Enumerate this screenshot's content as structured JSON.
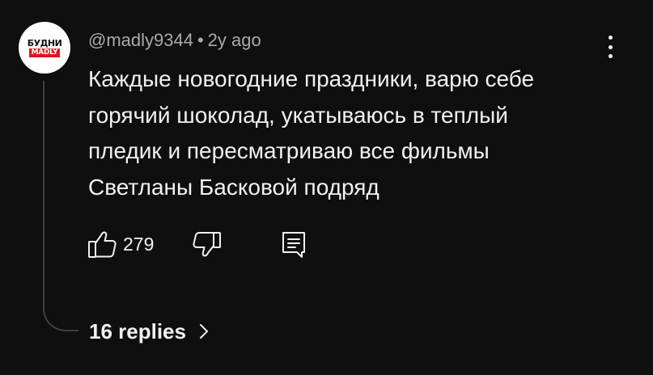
{
  "channel_avatar": {
    "line1": "БУДНИ",
    "line2": "MADLY",
    "accent": "#e3141e"
  },
  "comment": {
    "author": "@madly9344",
    "separator": "•",
    "time": "2y ago",
    "text_lines": [
      "Каждые новогодние праздники, варю себе",
      "горячий шоколад, укатываюсь в теплый",
      "пледик и пересматриваю все фильмы",
      "Светланы Басковой подряд"
    ],
    "like_count": "279"
  },
  "icons": {
    "menu": "more-vertical-icon",
    "like": "thumbs-up-icon",
    "dislike": "thumbs-down-icon",
    "reply": "comment-icon",
    "expand": "chevron-right-icon"
  },
  "replies": {
    "label": "16 replies"
  }
}
